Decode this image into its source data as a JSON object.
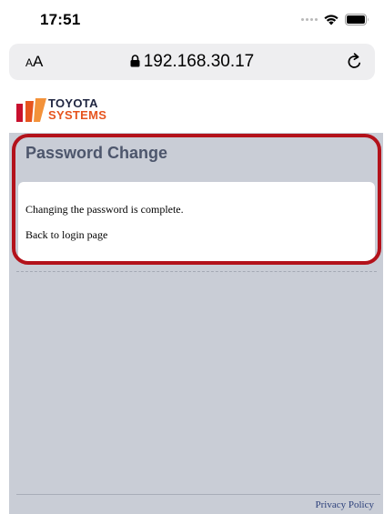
{
  "status_bar": {
    "time": "17:51"
  },
  "browser": {
    "text_size_label_small": "A",
    "text_size_label_large": "A",
    "url": "192.168.30.17"
  },
  "brand": {
    "line1": "TOYOTA",
    "line2": "SYSTEMS",
    "colors": {
      "orange": "#e6541e",
      "red": "#c8102e",
      "navy": "#1f2540"
    }
  },
  "page": {
    "title": "Password Change",
    "message": "Changing the password is complete.",
    "back_link": "Back to login page",
    "footer_link": "Privacy Policy"
  },
  "annotation": {
    "highlight_color": "#b3121b"
  },
  "icons": {
    "lock": "lock-icon",
    "reload": "reload-icon",
    "wifi": "wifi-icon",
    "battery": "battery-icon"
  }
}
